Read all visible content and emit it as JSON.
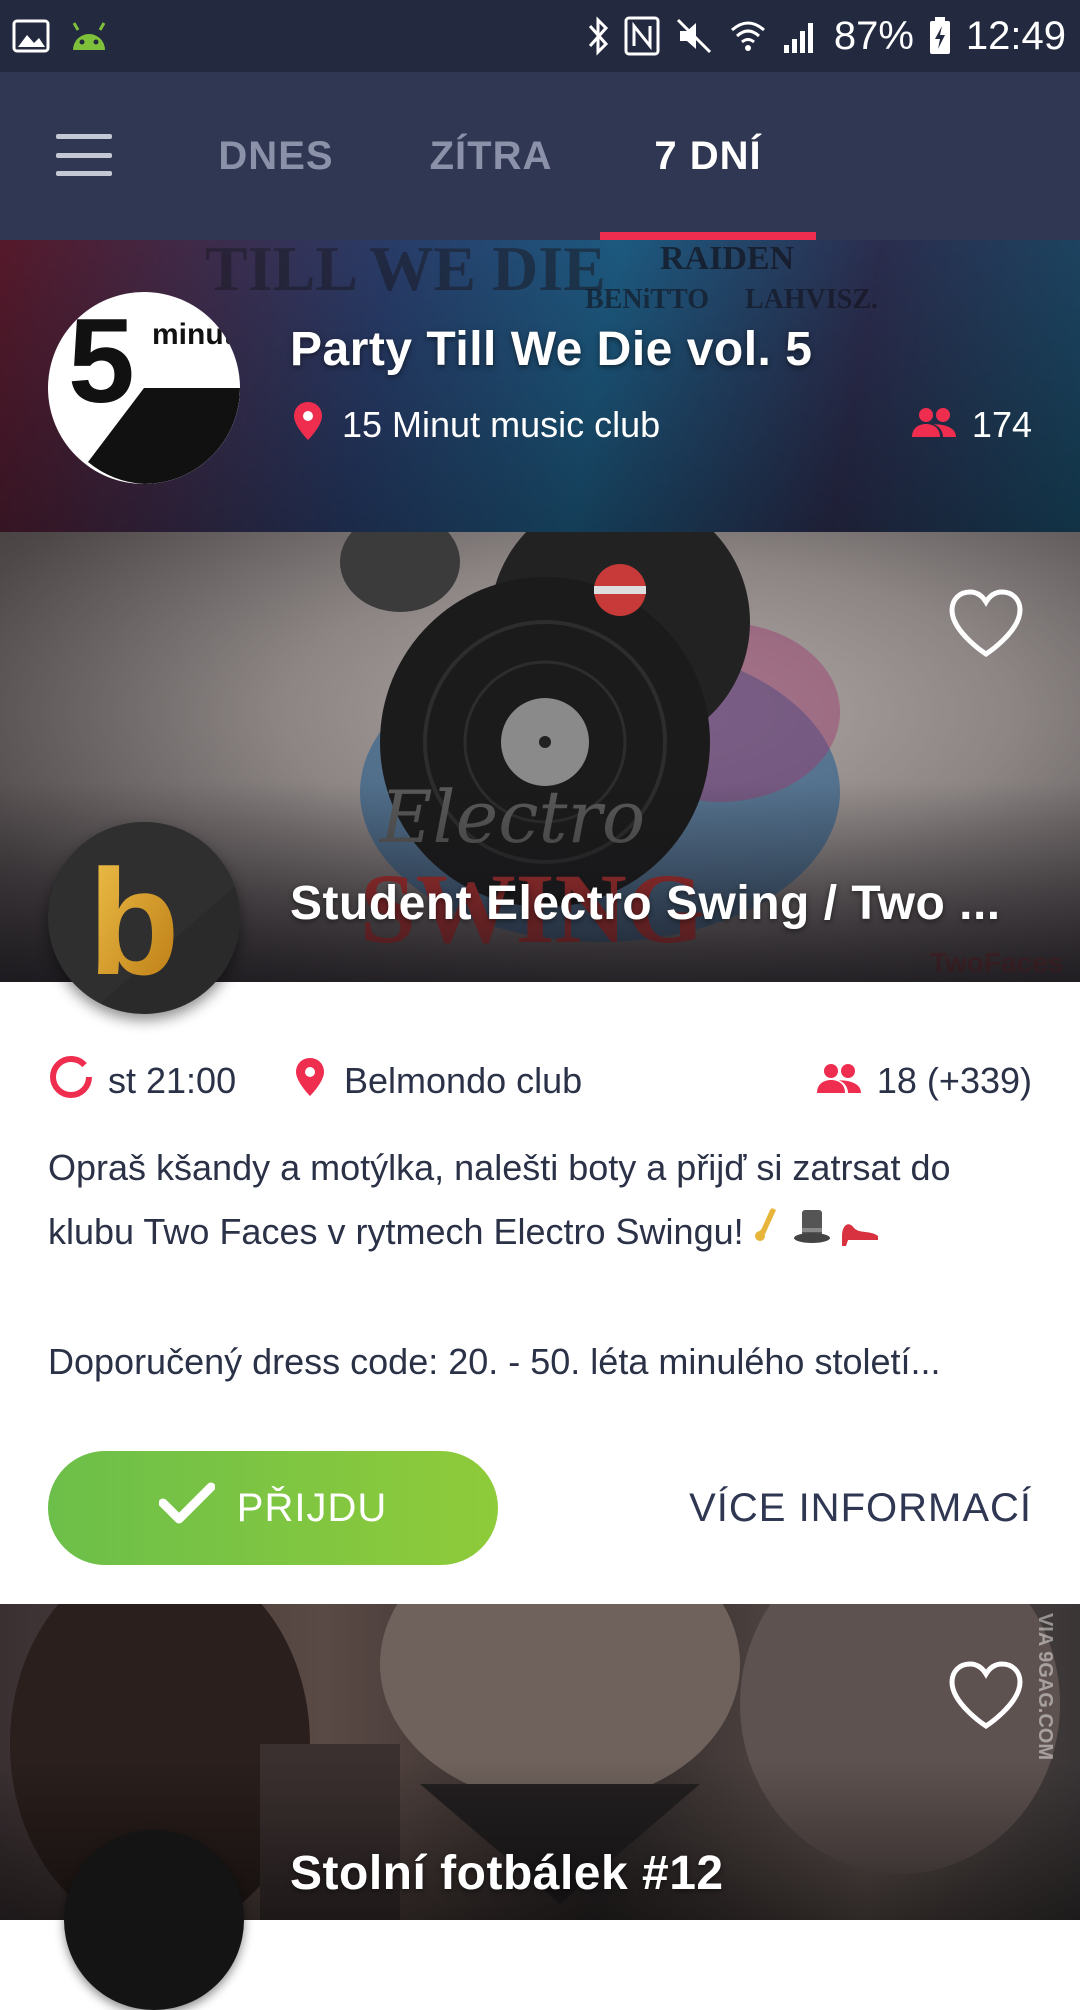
{
  "status_bar": {
    "battery": "87%",
    "time": "12:49",
    "icons": [
      "image-icon",
      "android-icon",
      "bluetooth-icon",
      "nfc-icon",
      "mute-icon",
      "wifi-icon",
      "signal-icon",
      "battery-charging-icon"
    ]
  },
  "nav": {
    "menu_icon": "hamburger-icon",
    "tabs": [
      {
        "label": "DNES",
        "active": false
      },
      {
        "label": "ZÍTRA",
        "active": false
      },
      {
        "label": "7 DNÍ",
        "active": true
      }
    ],
    "active_color": "#ef2d4f"
  },
  "events": [
    {
      "title": "Party Till We Die vol. 5",
      "venue": "15 Minut music club",
      "attendees": "174",
      "logo_text": "5",
      "logo_small": "minut",
      "poster_words": [
        "TILL WE DIE",
        "RAIDEN",
        "BENiTTO",
        "LAHVISZ."
      ]
    },
    {
      "title": "Student Electro Swing / Two ...",
      "time": "st 21:00",
      "venue": "Belmondo club",
      "attendees": "18 (+339)",
      "logo_text": "b",
      "poster_words": [
        "Electro",
        "SWING",
        "TwoFaces"
      ],
      "description": [
        "Opraš kšandy a motýlka, nalešti boty a přijď si zatrsat do klubu Two Faces v rytmech Electro Swingu!",
        "Doporučený dress code: 20. - 50. léta minulého století..."
      ],
      "going_label": "PŘIJDU",
      "more_label": "VÍCE INFORMACÍ"
    },
    {
      "title": "Stolní fotbálek #12",
      "watermark": "VIA 9GAG.COM"
    }
  ],
  "colors": {
    "status_bar": "#232a40",
    "app_bar": "#2f3752",
    "accent_red": "#ef2d4f",
    "going_green": "#7bc442"
  }
}
